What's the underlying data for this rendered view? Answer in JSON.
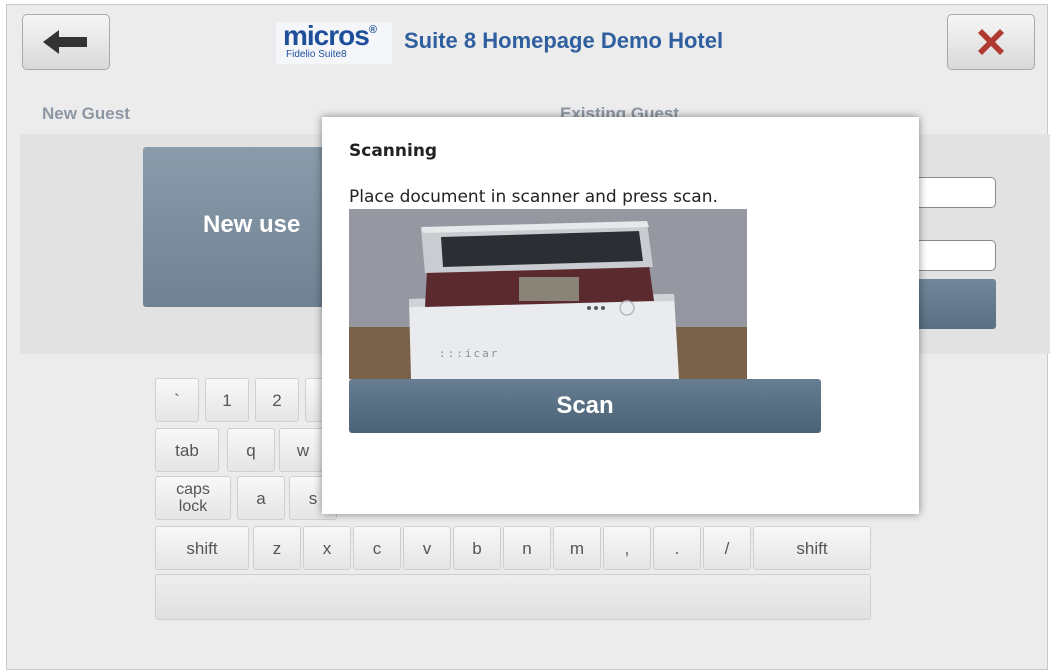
{
  "header": {
    "logo_main": "micros",
    "logo_sub": "Fidelio Suite8",
    "title": "Suite 8 Homepage Demo Hotel",
    "back_icon": "arrow-left-icon",
    "close_icon": "close-icon",
    "close_color": "#b03a30"
  },
  "sections": {
    "new_guest_label": "New Guest",
    "existing_guest_label": "Existing Guest",
    "new_user_button": "New use"
  },
  "keyboard": {
    "row1": [
      "`",
      "1",
      "2"
    ],
    "row2": [
      "tab",
      "q",
      "w"
    ],
    "row3": [
      "caps lock",
      "a",
      "s"
    ],
    "row4": [
      "shift",
      "z",
      "x",
      "c",
      "v",
      "b",
      "n",
      "m",
      ",",
      ".",
      "/",
      "shift"
    ]
  },
  "modal": {
    "title": "Scanning",
    "message": "Place document in scanner and press scan.",
    "image_brand": ":::icar",
    "scan_button": "Scan"
  },
  "colors": {
    "accent": "#2f5f9e",
    "button_dark": "#566c80",
    "background": "#ececec"
  }
}
